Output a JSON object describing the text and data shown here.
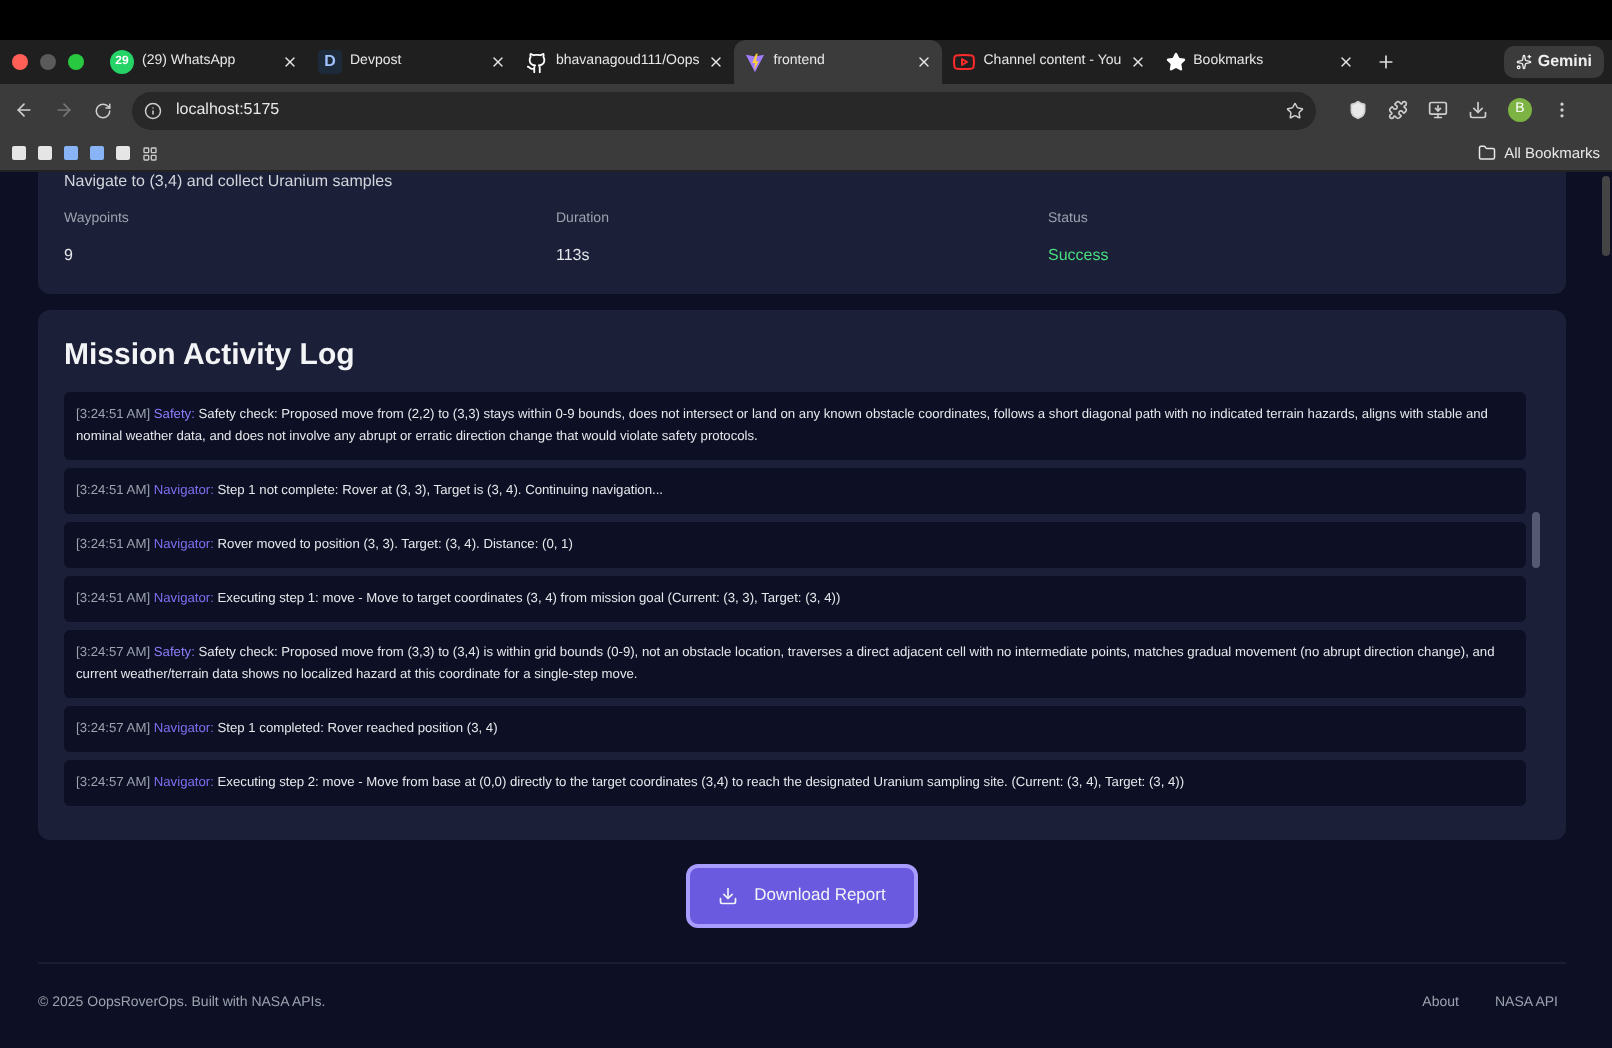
{
  "browser": {
    "tabs": [
      {
        "title": "(29) WhatsApp",
        "badge": "29",
        "selected": false
      },
      {
        "title": "Devpost",
        "badge": "D",
        "selected": false
      },
      {
        "title": "bhavanagoud111/Oops",
        "selected": false
      },
      {
        "title": "frontend",
        "selected": true
      },
      {
        "title": "Channel content - You",
        "selected": false
      },
      {
        "title": "Bookmarks",
        "selected": false
      }
    ],
    "gemini": "Gemini",
    "url": "localhost:5175",
    "avatar": "B",
    "all_bookmarks": "All Bookmarks"
  },
  "mission": {
    "goal": "Navigate to (3,4) and collect Uranium samples",
    "stats": [
      {
        "label": "Waypoints",
        "value": "9",
        "kind": "plain"
      },
      {
        "label": "Duration",
        "value": "113s",
        "kind": "plain"
      },
      {
        "label": "Status",
        "value": "Success",
        "kind": "success"
      }
    ]
  },
  "log": {
    "title": "Mission Activity Log",
    "entries": [
      {
        "time": "[3:24:51 AM]",
        "agent": "Safety:",
        "kind": "safety",
        "message": "Safety check: Proposed move from (2,2) to (3,3) stays within 0-9 bounds, does not intersect or land on any known obstacle coordinates, follows a short diagonal path with no indicated terrain hazards, aligns with stable and nominal weather data, and does not involve any abrupt or erratic direction change that would violate safety protocols."
      },
      {
        "time": "[3:24:51 AM]",
        "agent": "Navigator:",
        "kind": "navigator",
        "message": "Step 1 not complete: Rover at (3, 3), Target is (3, 4). Continuing navigation..."
      },
      {
        "time": "[3:24:51 AM]",
        "agent": "Navigator:",
        "kind": "navigator",
        "message": "Rover moved to position (3, 3). Target: (3, 4). Distance: (0, 1)"
      },
      {
        "time": "[3:24:51 AM]",
        "agent": "Navigator:",
        "kind": "navigator",
        "message": "Executing step 1: move - Move to target coordinates (3, 4) from mission goal (Current: (3, 3), Target: (3, 4))"
      },
      {
        "time": "[3:24:57 AM]",
        "agent": "Safety:",
        "kind": "safety",
        "message": "Safety check: Proposed move from (3,3) to (3,4) is within grid bounds (0-9), not an obstacle location, traverses a direct adjacent cell with no intermediate points, matches gradual movement (no abrupt direction change), and current weather/terrain data shows no localized hazard at this coordinate for a single-step move."
      },
      {
        "time": "[3:24:57 AM]",
        "agent": "Navigator:",
        "kind": "navigator",
        "message": "Step 1 completed: Rover reached position (3, 4)"
      },
      {
        "time": "[3:24:57 AM]",
        "agent": "Navigator:",
        "kind": "navigator",
        "message": "Executing step 2: move - Move from base at (0,0) directly to the target coordinates (3,4) to reach the designated Uranium sampling site. (Current: (3, 4), Target: (3, 4))"
      }
    ]
  },
  "download_button": "Download Report",
  "footer": {
    "copyright": "© 2025 OopsRoverOps. Built with NASA APIs.",
    "links": [
      "About",
      "NASA API"
    ]
  }
}
